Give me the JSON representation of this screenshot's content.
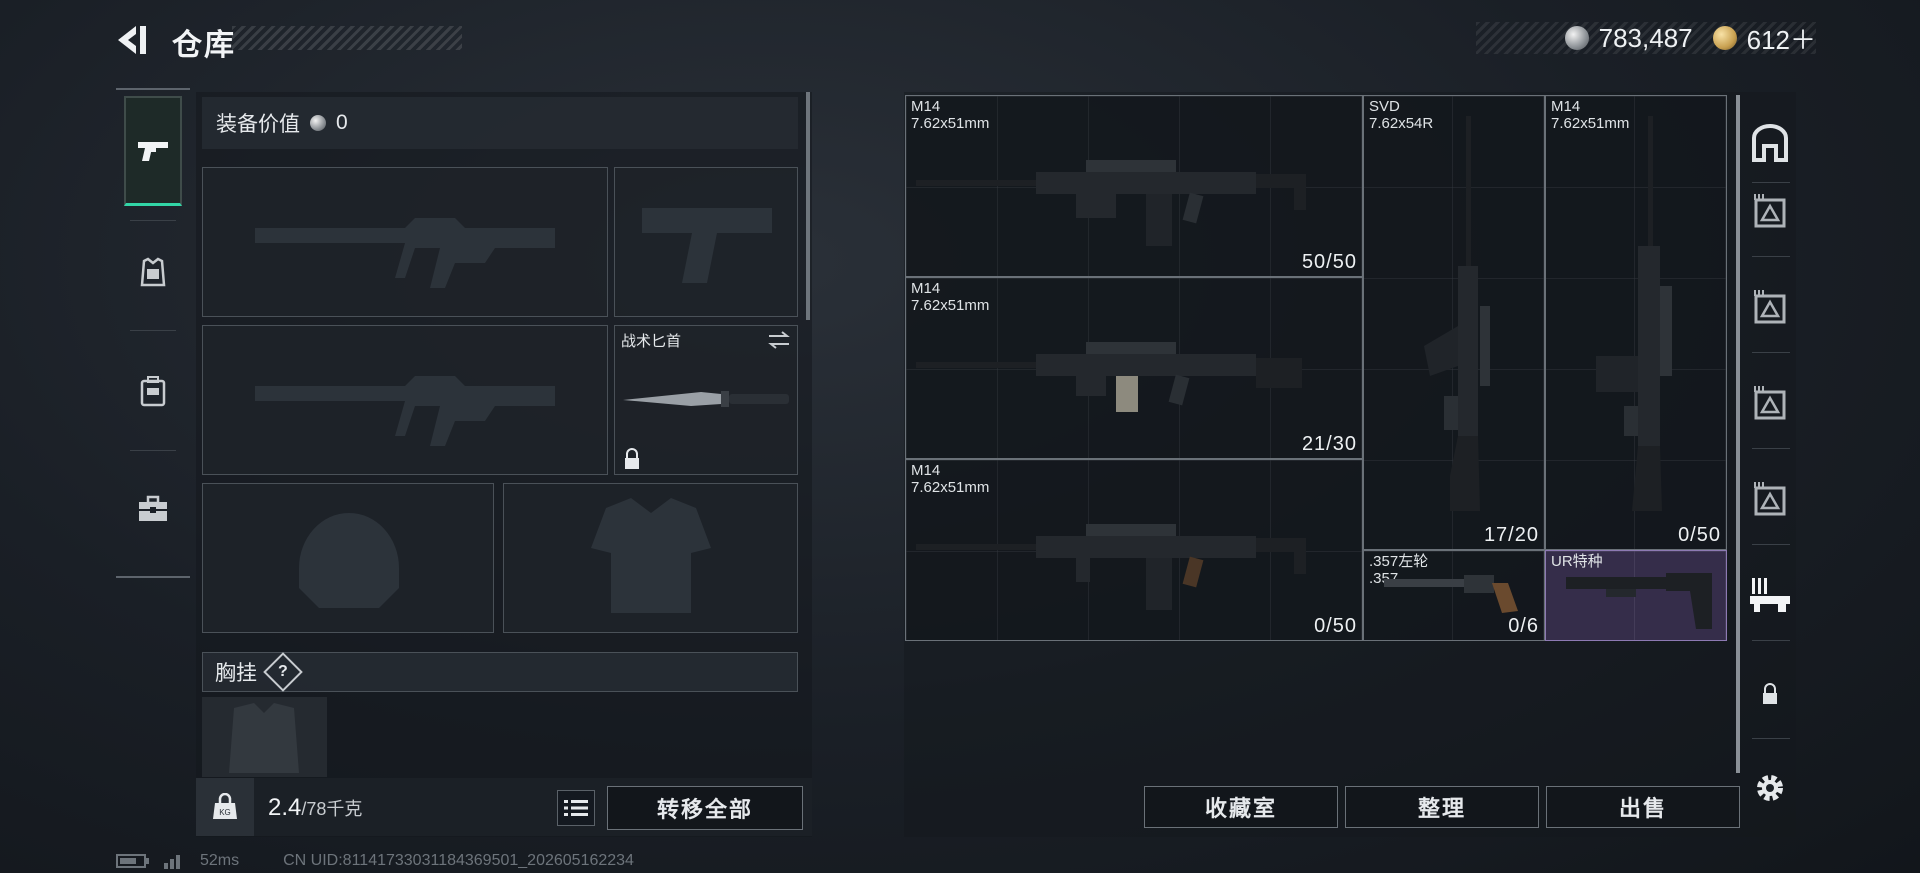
{
  "header": {
    "title": "仓库",
    "currency_silver": "783,487",
    "currency_gold": "612＋"
  },
  "left_tabs": [
    "pistol-icon",
    "armor-icon",
    "backpack-icon",
    "toolbox-icon"
  ],
  "equipment": {
    "value_label": "装备价值",
    "value": "0",
    "knife_label": "战术匕首",
    "chest_label": "胸挂",
    "help_label": "?",
    "weight_current": "2.4",
    "weight_max": "/78千克",
    "transfer_all_label": "转移全部"
  },
  "inventory": {
    "items": [
      {
        "name": "M14",
        "caliber": "7.62x51mm",
        "count": "50/50"
      },
      {
        "name": "M14",
        "caliber": "7.62x51mm",
        "count": "21/30"
      },
      {
        "name": "M14",
        "caliber": "7.62x51mm",
        "count": "0/50"
      },
      {
        "name": "SVD",
        "caliber": "7.62x54R",
        "count": "17/20"
      },
      {
        "name": "M14",
        "caliber": "7.62x51mm",
        "count": "0/50"
      },
      {
        "name": ".357左轮",
        "caliber": ".357",
        "count": "0/6"
      },
      {
        "name": "UR特种",
        "caliber": "",
        "count": ""
      }
    ],
    "buttons": {
      "collection": "收藏室",
      "organize": "整理",
      "sell": "出售"
    }
  },
  "status": {
    "ping": "52ms",
    "uid": "CN UID:81141733031184369501_202605162234"
  },
  "colors": {
    "accent_green": "#32d6a7",
    "ur_purple": "#8d7ab3"
  }
}
